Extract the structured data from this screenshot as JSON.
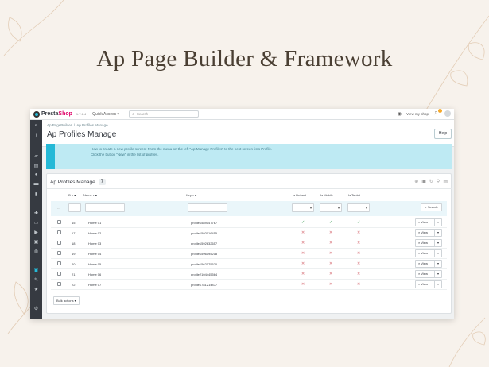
{
  "hero_title": "Ap Page Builder & Framework",
  "topbar": {
    "brand_pre": "Presta",
    "brand_post": "Shop",
    "version": "1.7.6.4",
    "quick_access": "Quick Access ▾",
    "search_placeholder": "Search",
    "view_shop": "View my shop",
    "notifications": "1"
  },
  "breadcrumb": {
    "parent": "Ap PageBuilder",
    "current": "Ap Profiles Manage"
  },
  "page_title": "Ap Profiles Manage",
  "help_label": "Help",
  "alert": {
    "line1": "How to create a new profile screen: From the menu on the left \"Ap Manage Profiles\" to the next screen lists Profile.",
    "line2": "Click the button \"New\" in the list of profiles."
  },
  "panel": {
    "title": "Ap Profiles Manage",
    "count": "7"
  },
  "columns": {
    "id": "ID ▾ ▴",
    "name": "Name ▾ ▴",
    "key": "Key ▾ ▴",
    "default": "Is Default",
    "mobile": "Is Mobile",
    "tablet": "Is Tablet"
  },
  "search_button": "Search",
  "view_label": "View",
  "rows": [
    {
      "id": "15",
      "name": "Home 01",
      "key": "profile1589147767",
      "default": true,
      "mobile": true,
      "tablet": true
    },
    {
      "id": "17",
      "name": "Home 02",
      "key": "profile1592016455",
      "default": false,
      "mobile": false,
      "tablet": false
    },
    {
      "id": "18",
      "name": "Home 03",
      "key": "profile1592632657",
      "default": false,
      "mobile": false,
      "tablet": false
    },
    {
      "id": "19",
      "name": "Home 04",
      "key": "profile1596195218",
      "default": false,
      "mobile": false,
      "tablet": false
    },
    {
      "id": "20",
      "name": "Home 05",
      "key": "profile1562175620",
      "default": false,
      "mobile": false,
      "tablet": false
    },
    {
      "id": "21",
      "name": "Home 06",
      "key": "profile2104445564",
      "default": false,
      "mobile": false,
      "tablet": false
    },
    {
      "id": "22",
      "name": "Home 07",
      "key": "profile1781214477",
      "default": false,
      "mobile": false,
      "tablet": false
    }
  ],
  "bulk_actions": "Bulk actions ▾",
  "colors": {
    "accent": "#25b9d7",
    "sidebar": "#363a41",
    "ok": "#70b580",
    "no": "#e08f95"
  }
}
